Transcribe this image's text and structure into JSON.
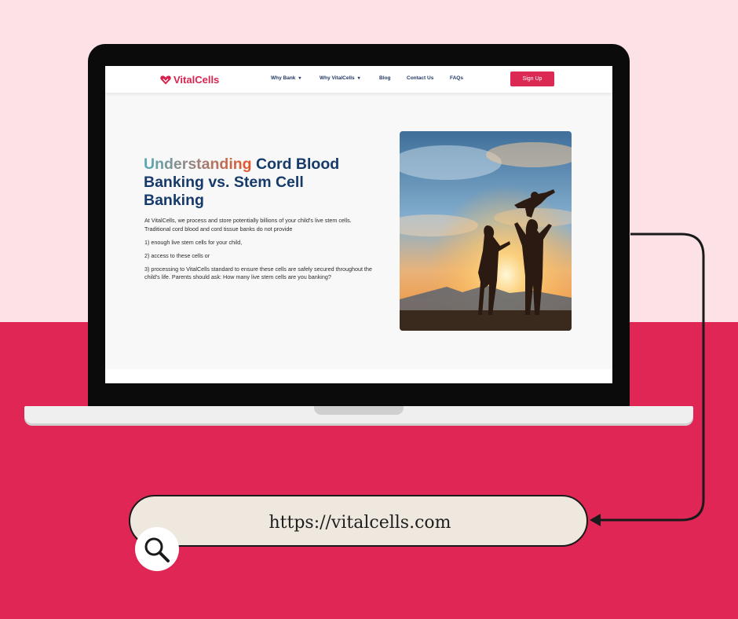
{
  "colors": {
    "background_top": "#fce2e6",
    "background_bottom": "#e02654",
    "accent": "#dc2954",
    "navy": "#163a6a"
  },
  "site": {
    "logo": {
      "brand": "VitalCells",
      "icon": "heart-logo-icon"
    },
    "nav": {
      "items": [
        {
          "label": "Why Bank",
          "has_dropdown": true
        },
        {
          "label": "Why VitalCells",
          "has_dropdown": true
        },
        {
          "label": "Blog",
          "has_dropdown": false
        },
        {
          "label": "Contact Us",
          "has_dropdown": false
        },
        {
          "label": "FAQs",
          "has_dropdown": false
        }
      ],
      "signup_label": "Sign Up"
    },
    "hero": {
      "title_highlight": "Understanding",
      "title_rest": " Cord Blood Banking vs. Stem Cell Banking",
      "paragraphs": [
        "At VitalCells, we process and store potentially billions of your child's live stem cells. Traditional cord blood and cord tissue banks do not provide",
        "1) enough live stem cells for your child,",
        "2) access to these cells or",
        "3) processing to VitalCells standard to ensure these cells are safely secured throughout the child's life. Parents should ask: How many live stem cells are you banking?"
      ],
      "image_description": "family-silhouette-sunset-photo"
    }
  },
  "address_bar": {
    "url": "https://vitalcells.com",
    "icon": "search-icon"
  }
}
